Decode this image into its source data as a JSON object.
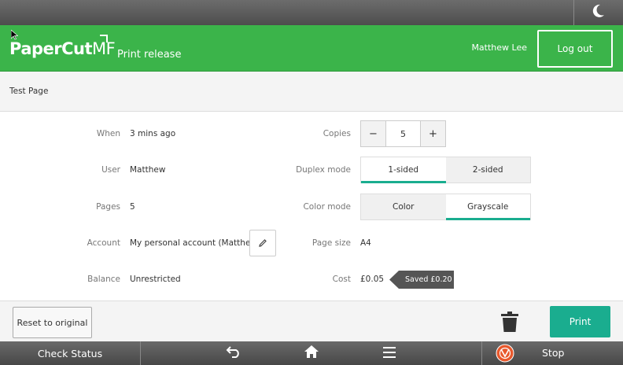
{
  "header": {
    "logo_main": "PaperCut",
    "logo_suffix": "MF",
    "app_title": "Print release",
    "username": "Matthew Lee",
    "logout_label": "Log out"
  },
  "document": {
    "title": "Test Page"
  },
  "details": {
    "when_label": "When",
    "when_value": "3 mins ago",
    "user_label": "User",
    "user_value": "Matthew",
    "pages_label": "Pages",
    "pages_value": "5",
    "account_label": "Account",
    "account_value": "My personal account (Matthew)",
    "balance_label": "Balance",
    "balance_value": "Unrestricted"
  },
  "options": {
    "copies_label": "Copies",
    "copies_minus": "−",
    "copies_value": "5",
    "copies_plus": "+",
    "duplex_label": "Duplex mode",
    "duplex_options": [
      "1-sided",
      "2-sided"
    ],
    "duplex_selected": "1-sided",
    "color_label": "Color mode",
    "color_options": [
      "Color",
      "Grayscale"
    ],
    "color_selected": "Grayscale",
    "pagesize_label": "Page size",
    "pagesize_value": "A4",
    "cost_label": "Cost",
    "cost_value": "£0.05",
    "saved_label": "Saved £0.20"
  },
  "actions": {
    "reset_label": "Reset to original",
    "print_label": "Print",
    "delete_icon": "trash-icon"
  },
  "navbar": {
    "check_status_label": "Check Status",
    "stop_label": "Stop",
    "icons": [
      "back-icon",
      "home-icon",
      "menu-icon",
      "stop-icon"
    ]
  },
  "system": {
    "night_mode_icon": "moon-icon"
  },
  "colors": {
    "header_green": "#3bb44a",
    "accent_teal": "#1aad8f",
    "stop_orange": "#e8582c"
  }
}
